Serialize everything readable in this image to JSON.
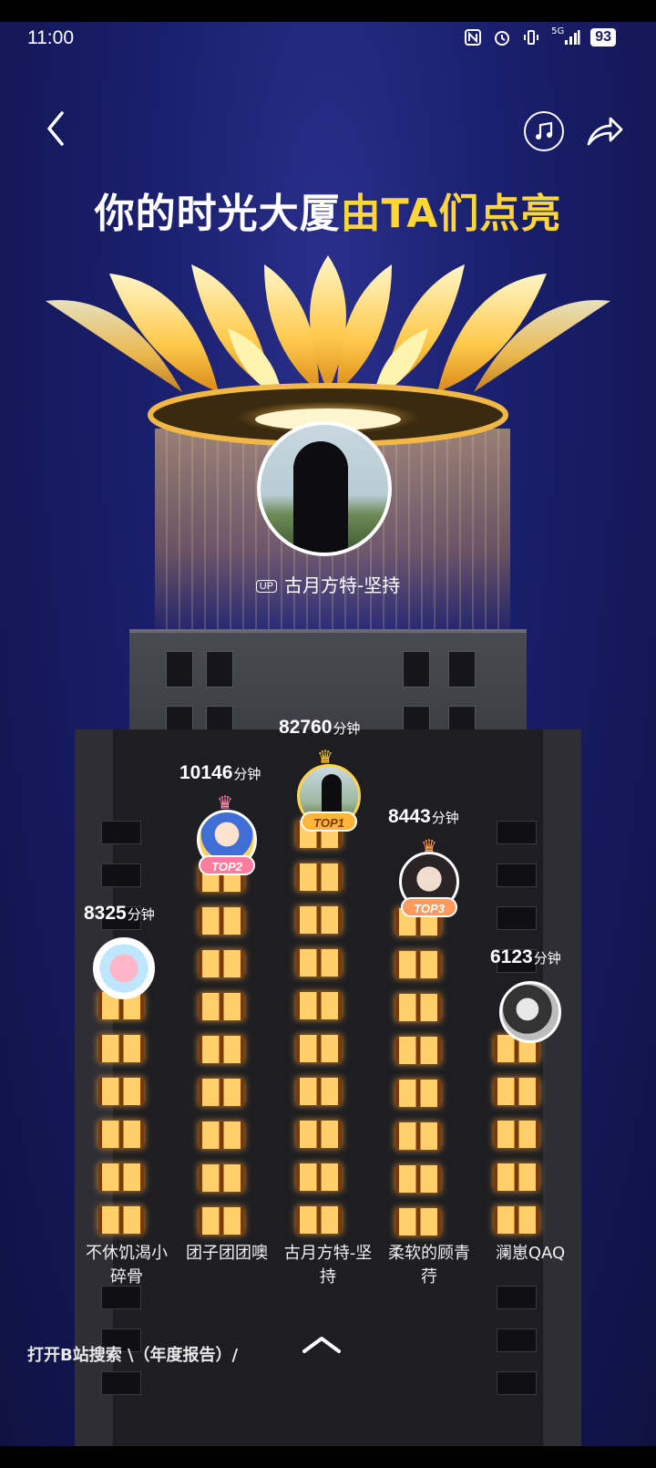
{
  "status_bar": {
    "time": "11:00",
    "network": "5G",
    "battery": "93"
  },
  "header": {
    "title_main": "你的时光大厦",
    "title_highlight": "由TA们点亮"
  },
  "top_uploader": {
    "badge": "UP",
    "name": "古月方特-坚持"
  },
  "ranking": [
    {
      "minutes": "82760",
      "unit": "分钟",
      "rank_label": "TOP1",
      "name_line1": "古月方特-坚",
      "name_line2": "持"
    },
    {
      "minutes": "10146",
      "unit": "分钟",
      "rank_label": "TOP2",
      "name_line1": "团子团团噢",
      "name_line2": ""
    },
    {
      "minutes": "8443",
      "unit": "分钟",
      "rank_label": "TOP3",
      "name_line1": "柔软的顾青",
      "name_line2": "荇"
    },
    {
      "minutes": "8325",
      "unit": "分钟",
      "rank_label": "",
      "name_line1": "不休饥渴小",
      "name_line2": "碎骨"
    },
    {
      "minutes": "6123",
      "unit": "分钟",
      "rank_label": "",
      "name_line1": "澜崽QAQ",
      "name_line2": ""
    }
  ],
  "footer": {
    "hint": "打开B站搜索 \\（年度报告）/"
  },
  "colors": {
    "highlight": "#ffd63a",
    "top1": "#ffb53a",
    "top2": "#ff7d9a",
    "top3": "#ff9a5a"
  }
}
